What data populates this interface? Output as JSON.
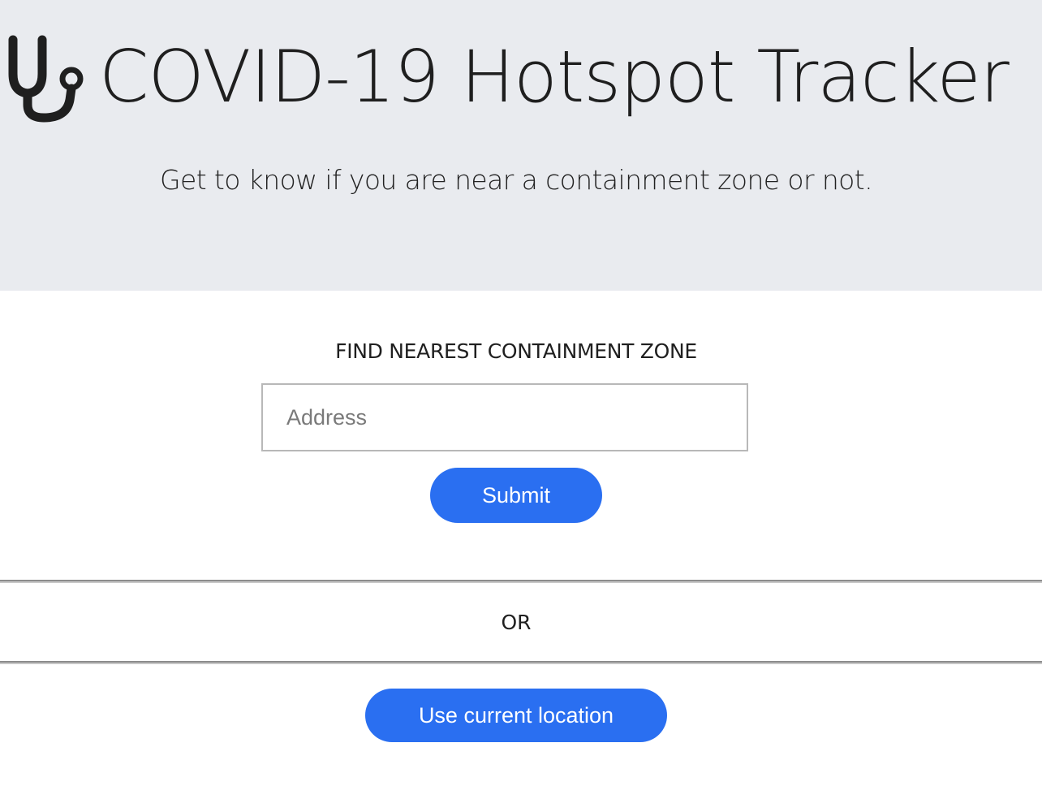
{
  "header": {
    "logo_icon": "stethoscope-icon",
    "title": "COVID-19 Hotspot Tracker",
    "subtitle": "Get to know if you are near a containment zone or not.",
    "background_color": "#e9ebef"
  },
  "search": {
    "heading": "FIND NEAREST CONTAINMENT ZONE",
    "address_placeholder": "Address",
    "address_value": "",
    "submit_label": "Submit"
  },
  "separator": {
    "or_label": "OR"
  },
  "location": {
    "use_current_location_label": "Use current location"
  },
  "colors": {
    "accent": "#2a6ff1",
    "text": "#1f1f1f",
    "button_text": "#ffffff"
  }
}
